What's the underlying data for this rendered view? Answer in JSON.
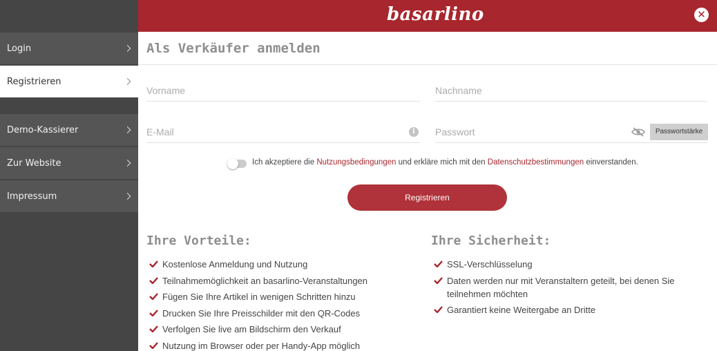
{
  "sidebar": {
    "items": [
      {
        "label": "Login"
      },
      {
        "label": "Registrieren"
      },
      {
        "label": "Demo-Kassierer"
      },
      {
        "label": "Zur Website"
      },
      {
        "label": "Impressum"
      }
    ],
    "active_index": 1
  },
  "header": {
    "logo_text": "basarlino",
    "close_icon": "close-icon",
    "brand_color": "#a8262d"
  },
  "form": {
    "title": "Als Verkäufer anmelden",
    "vorname_placeholder": "Vorname",
    "nachname_placeholder": "Nachname",
    "email_placeholder": "E-Mail",
    "passwort_placeholder": "Passwort",
    "password_strength_button": "Passwortstärke",
    "consent_toggle_on": false,
    "consent_prefix": "Ich akzeptiere die",
    "consent_link_terms": "Nutzungsbedingungen",
    "consent_middle": "und erkläre mich mit den",
    "consent_link_privacy": "Datenschutzbestimmungen",
    "consent_suffix": "einverstanden.",
    "submit_label": "Registrieren"
  },
  "advantages": {
    "title": "Ihre Vorteile:",
    "items": [
      "Kostenlose Anmeldung und Nutzung",
      "Teilnahmemöglichkeit an basarlino-Veranstaltungen",
      "Fügen Sie Ihre Artikel in wenigen Schritten hinzu",
      "Drucken Sie Ihre Preisschilder mit den QR-Codes",
      "Verfolgen Sie live am Bildschirm den Verkauf",
      "Nutzung im Browser oder per Handy-App möglich"
    ]
  },
  "security": {
    "title": "Ihre Sicherheit:",
    "items": [
      "SSL-Verschlüsselung",
      "Daten werden nur mit Veranstaltern geteilt, bei denen Sie teilnehmen möchten",
      "Garantiert keine Weitergabe an Dritte"
    ]
  },
  "icons": {
    "info": "info-icon",
    "password_visibility": "eye-slash-icon",
    "list_bullet": "check-icon",
    "sidebar_chevron": "chevron-right-icon"
  }
}
